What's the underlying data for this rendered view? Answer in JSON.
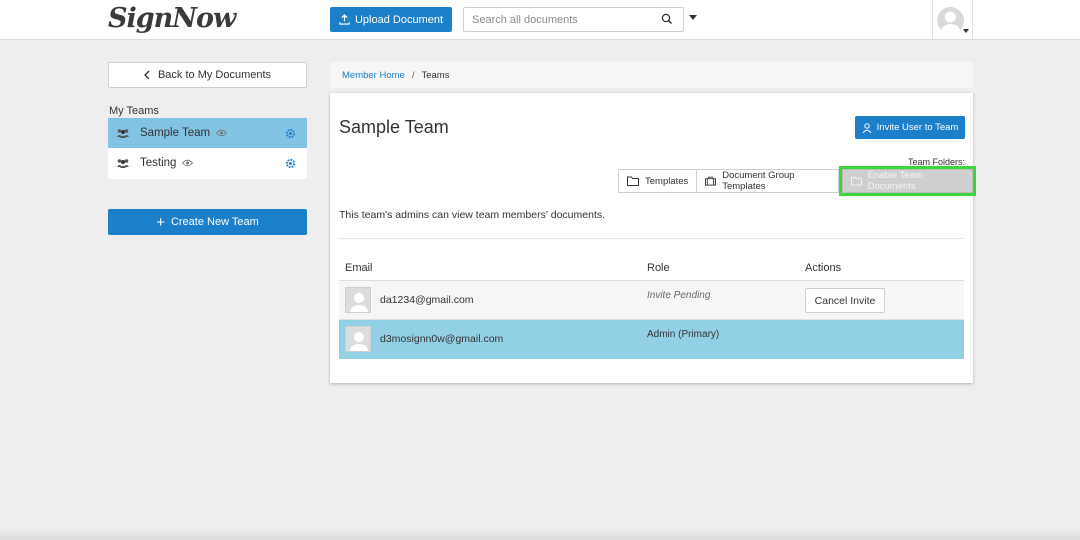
{
  "header": {
    "logo_text": "SignNow",
    "upload_label": "Upload Document",
    "search_placeholder": "Search all documents"
  },
  "sidebar": {
    "back_label": "Back to My Documents",
    "my_teams_label": "My Teams",
    "teams": [
      {
        "name": "Sample Team",
        "active": true
      },
      {
        "name": "Testing",
        "active": false
      }
    ],
    "create_team_label": "Create New Team"
  },
  "breadcrumb": {
    "home": "Member Home",
    "separator": "/",
    "current": "Teams"
  },
  "panel": {
    "title": "Sample Team",
    "invite_label": "Invite User to Team",
    "folders_label": "Team Folders:",
    "folder_tabs": {
      "templates": "Templates",
      "group_templates": "Document Group Templates",
      "enable_docs": "Enable Team Documents"
    },
    "info_text": "This team's admins can view team members' documents."
  },
  "table": {
    "headers": {
      "email": "Email",
      "role": "Role",
      "actions": "Actions"
    },
    "rows": [
      {
        "email": "da1234@gmail.com",
        "role": "Invite Pending",
        "action": "Cancel Invite"
      },
      {
        "email": "d3mosignn0w@gmail.com",
        "role": "Admin (Primary)",
        "action": ""
      }
    ]
  },
  "colors": {
    "accent": "#1b7fc9",
    "active_team_bg": "#82c3e4",
    "selected_row_bg": "#92d0e6",
    "highlight_outline": "#3ed43e"
  }
}
